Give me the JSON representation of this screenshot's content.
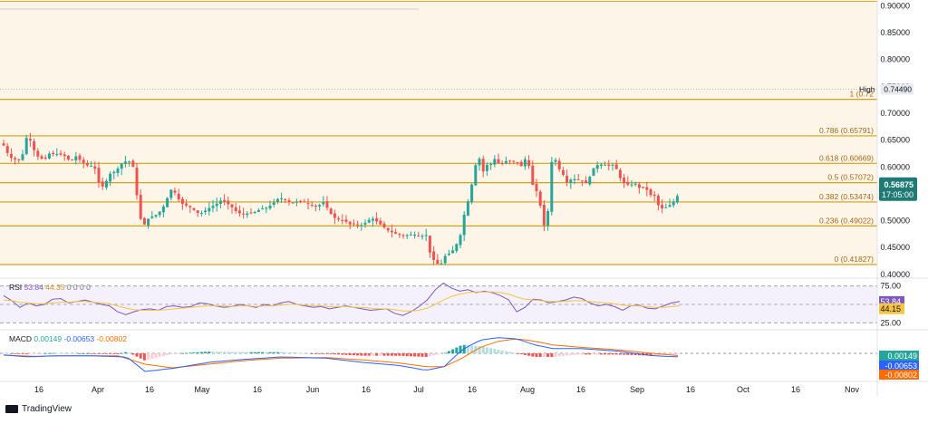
{
  "chart_data": [
    {
      "type": "candlestick",
      "name": "price",
      "yticks": [
        "0.40000",
        "0.45000",
        "0.50000",
        "0.55000",
        "0.60000",
        "0.65000",
        "0.70000",
        "0.75000",
        "0.80000",
        "0.85000",
        "0.90000"
      ],
      "ylim": [
        0.398,
        0.9075
      ],
      "high_label": "High",
      "high_value": "0.74490",
      "last_price": "0.56875",
      "countdown": "17:05:00",
      "fib_levels": [
        {
          "label": "1 (0.72",
          "value": 0.7259
        },
        {
          "label": "0.786 (0.65791)",
          "value": 0.65791
        },
        {
          "label": "0.618 (0.60669)",
          "value": 0.60669
        },
        {
          "label": "0.5 (0.57072)",
          "value": 0.57072
        },
        {
          "label": "0.382 (0.53474)",
          "value": 0.53474
        },
        {
          "label": "0.236 (0.49022)",
          "value": 0.49022
        },
        {
          "label": "0 (0.41827)",
          "value": 0.41827
        }
      ],
      "fib_top_value": 0.9085,
      "colors": {
        "up": "#26a69a",
        "down": "#ef5350",
        "fib": "#d4a017",
        "fib_fill": "#fdf6e8",
        "last_price_bg": "#1f7a74"
      }
    },
    {
      "type": "line",
      "name": "RSI",
      "label": "RSI",
      "label_values": [
        "53.84",
        "44.35",
        "0",
        "0",
        "0",
        "0"
      ],
      "badges": [
        "53.84",
        "44.15"
      ],
      "yticks": [
        "75.00",
        "25.00"
      ],
      "ylim": [
        18,
        82
      ],
      "series": [
        {
          "name": "RSI",
          "color": "#7e57c2",
          "values": [
            62,
            55,
            46,
            52,
            48,
            50,
            57,
            58,
            52,
            54,
            56,
            53,
            50,
            48,
            40,
            36,
            40,
            43,
            44,
            42,
            47,
            48,
            46,
            47,
            52,
            51,
            48,
            46,
            47,
            50,
            48,
            46,
            50,
            48,
            52,
            54,
            50,
            48,
            46,
            47,
            44,
            46,
            48,
            46,
            44,
            42,
            43,
            44,
            38,
            35,
            40,
            47,
            56,
            70,
            79,
            72,
            68,
            70,
            66,
            68,
            66,
            62,
            56,
            40,
            46,
            57,
            56,
            52,
            54,
            56,
            60,
            58,
            52,
            48,
            50,
            47,
            42,
            48,
            49,
            45,
            44,
            48,
            52,
            54
          ]
        },
        {
          "name": "RSI-based MA",
          "color": "#f5c542",
          "values": [
            56,
            55,
            53,
            52,
            51,
            51,
            52,
            53,
            53,
            54,
            54,
            53,
            52,
            51,
            48,
            45,
            43,
            42,
            42,
            42,
            43,
            44,
            45,
            46,
            47,
            48,
            48,
            48,
            47,
            48,
            48,
            47,
            48,
            48,
            49,
            50,
            50,
            49,
            48,
            48,
            47,
            47,
            47,
            46,
            46,
            45,
            44,
            44,
            43,
            41,
            41,
            42,
            45,
            50,
            56,
            61,
            64,
            66,
            67,
            67,
            67,
            66,
            64,
            60,
            57,
            56,
            55,
            54,
            54,
            54,
            55,
            55,
            54,
            53,
            52,
            51,
            49,
            48,
            48,
            47,
            46,
            46,
            47,
            48
          ]
        }
      ]
    },
    {
      "type": "bar+line",
      "name": "MACD",
      "label": "MACD",
      "label_values": [
        "0.00149",
        "-0.00653",
        "-0.00802"
      ],
      "badges": [
        "0.00149",
        "-0.00653",
        "-0.00802"
      ],
      "ylim": [
        -0.042,
        0.036
      ],
      "colors": {
        "macd": "#2962ff",
        "signal": "#ff6d00",
        "hist_up": "#26a69a",
        "hist_up_light": "#b2dfdb",
        "hist_down": "#ef5350",
        "hist_down_light": "#ffcdd2"
      }
    }
  ],
  "xaxis": {
    "labels": [
      "16",
      "Apr",
      "16",
      "May",
      "16",
      "Jun",
      "16",
      "Jul",
      "16",
      "Aug",
      "16",
      "Sep",
      "16",
      "Oct",
      "16",
      "Nov"
    ]
  },
  "brand": {
    "name": "TradingView"
  }
}
